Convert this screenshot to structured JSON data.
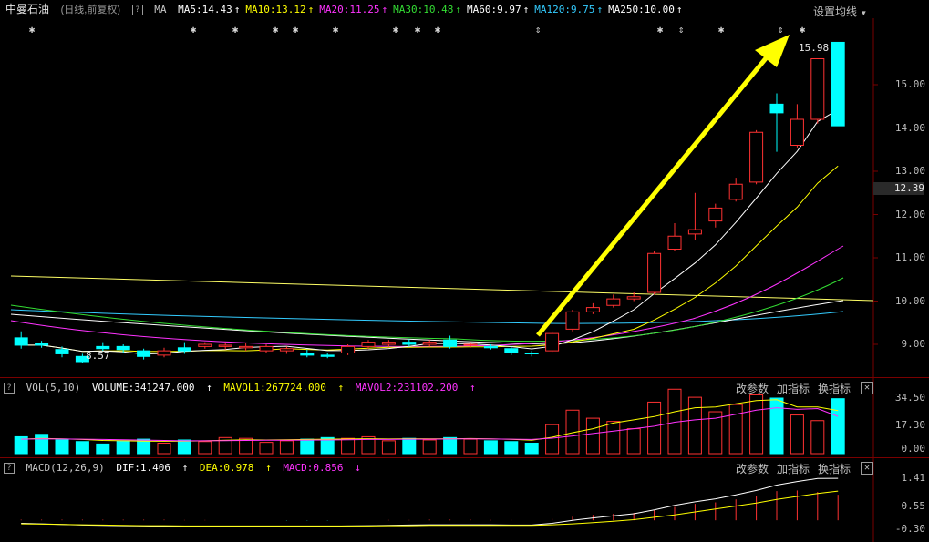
{
  "main": {
    "stock_name": "中曼石油",
    "mode": "(日线,前复权)",
    "indicator": "MA",
    "ma": [
      {
        "label": "MA5:14.43",
        "color": "#ffffff"
      },
      {
        "label": "MA10:13.12",
        "color": "#ffff00"
      },
      {
        "label": "MA20:11.25",
        "color": "#ff33ff"
      },
      {
        "label": "MA30:10.48",
        "color": "#33dd33"
      },
      {
        "label": "MA60:9.97",
        "color": "#ffffff"
      },
      {
        "label": "MA120:9.75",
        "color": "#33ccff"
      },
      {
        "label": "MA250:10.00",
        "color": "#ffffff"
      }
    ],
    "settings_label": "设置均线",
    "price_axis": [
      "15.00",
      "14.00",
      "13.00",
      "12.00",
      "11.00",
      "10.00",
      "9.00"
    ],
    "current_price": "12.39",
    "high_label": "15.98",
    "low_label": "8.57",
    "up_color": "#ff3232",
    "down_color": "#00ffff"
  },
  "volume": {
    "indicator": "VOL(5,10)",
    "volume_label": "VOLUME:341247.000",
    "mavol1_label": "MAVOL1:267724.000",
    "mavol2_label": "MAVOL2:231102.200",
    "axis": [
      "34.50",
      "17.30",
      "0.00"
    ]
  },
  "macd": {
    "indicator": "MACD(12,26,9)",
    "dif_label": "DIF:1.406",
    "dea_label": "DEA:0.978",
    "macd_label": "MACD:0.856",
    "axis": [
      "1.41",
      "0.55",
      "-0.30"
    ]
  },
  "panel_buttons": {
    "change_params": "改参数",
    "add_indicator": "加指标",
    "switch_indicator": "换指标"
  },
  "chart_data": {
    "type": "candlestick",
    "ylim": [
      8.5,
      16.3
    ],
    "candles": [
      {
        "o": 9.15,
        "c": 8.98,
        "h": 9.3,
        "l": 8.9
      },
      {
        "o": 9.02,
        "c": 8.98,
        "h": 9.08,
        "l": 8.92
      },
      {
        "o": 8.88,
        "c": 8.78,
        "h": 8.95,
        "l": 8.7
      },
      {
        "o": 8.72,
        "c": 8.6,
        "h": 8.78,
        "l": 8.57
      },
      {
        "o": 8.95,
        "c": 8.9,
        "h": 9.05,
        "l": 8.85
      },
      {
        "o": 8.95,
        "c": 8.88,
        "h": 9.0,
        "l": 8.8
      },
      {
        "o": 8.85,
        "c": 8.72,
        "h": 8.9,
        "l": 8.65
      },
      {
        "o": 8.75,
        "c": 8.85,
        "h": 8.92,
        "l": 8.7
      },
      {
        "o": 8.92,
        "c": 8.85,
        "h": 9.05,
        "l": 8.78
      },
      {
        "o": 8.95,
        "c": 9.0,
        "h": 9.05,
        "l": 8.9
      },
      {
        "o": 8.95,
        "c": 8.98,
        "h": 9.05,
        "l": 8.88
      },
      {
        "o": 8.92,
        "c": 8.95,
        "h": 9.02,
        "l": 8.85
      },
      {
        "o": 8.85,
        "c": 8.95,
        "h": 9.0,
        "l": 8.8
      },
      {
        "o": 8.85,
        "c": 8.9,
        "h": 8.95,
        "l": 8.78
      },
      {
        "o": 8.8,
        "c": 8.75,
        "h": 8.88,
        "l": 8.7
      },
      {
        "o": 8.75,
        "c": 8.72,
        "h": 8.8,
        "l": 8.68
      },
      {
        "o": 8.8,
        "c": 8.95,
        "h": 9.0,
        "l": 8.75
      },
      {
        "o": 8.95,
        "c": 9.05,
        "h": 9.1,
        "l": 8.9
      },
      {
        "o": 9.0,
        "c": 9.05,
        "h": 9.1,
        "l": 8.95
      },
      {
        "o": 9.05,
        "c": 9.0,
        "h": 9.12,
        "l": 8.95
      },
      {
        "o": 9.0,
        "c": 9.05,
        "h": 9.1,
        "l": 8.95
      },
      {
        "o": 9.1,
        "c": 8.95,
        "h": 9.2,
        "l": 8.9
      },
      {
        "o": 8.98,
        "c": 9.0,
        "h": 9.05,
        "l": 8.92
      },
      {
        "o": 8.95,
        "c": 8.92,
        "h": 9.0,
        "l": 8.88
      },
      {
        "o": 8.9,
        "c": 8.82,
        "h": 8.95,
        "l": 8.75
      },
      {
        "o": 8.8,
        "c": 8.78,
        "h": 8.85,
        "l": 8.72
      },
      {
        "o": 8.85,
        "c": 9.25,
        "h": 9.3,
        "l": 8.82
      },
      {
        "o": 9.35,
        "c": 9.75,
        "h": 9.8,
        "l": 9.3
      },
      {
        "o": 9.75,
        "c": 9.85,
        "h": 9.95,
        "l": 9.7
      },
      {
        "o": 9.9,
        "c": 10.05,
        "h": 10.15,
        "l": 9.85
      },
      {
        "o": 10.05,
        "c": 10.1,
        "h": 10.2,
        "l": 10.0
      },
      {
        "o": 10.2,
        "c": 11.1,
        "h": 11.15,
        "l": 10.15
      },
      {
        "o": 11.2,
        "c": 11.5,
        "h": 11.8,
        "l": 11.15
      },
      {
        "o": 11.55,
        "c": 11.65,
        "h": 12.5,
        "l": 11.4
      },
      {
        "o": 11.85,
        "c": 12.15,
        "h": 12.25,
        "l": 11.7
      },
      {
        "o": 12.35,
        "c": 12.7,
        "h": 12.85,
        "l": 12.3
      },
      {
        "o": 12.75,
        "c": 13.9,
        "h": 13.95,
        "l": 12.7
      },
      {
        "o": 14.55,
        "c": 14.35,
        "h": 14.8,
        "l": 13.45
      },
      {
        "o": 13.6,
        "c": 14.2,
        "h": 14.55,
        "l": 13.55
      },
      {
        "o": 14.2,
        "c": 15.6,
        "h": 15.6,
        "l": 14.1
      },
      {
        "o": 15.98,
        "c": 14.05,
        "h": 15.98,
        "l": 14.05
      }
    ],
    "volume": [
      10.5,
      12.0,
      8.5,
      7.5,
      6.0,
      8.0,
      9.0,
      6.5,
      8.5,
      7.5,
      10.0,
      9.5,
      7.0,
      8.0,
      9.0,
      10.0,
      9.5,
      10.5,
      8.0,
      9.5,
      8.5,
      10.0,
      9.0,
      8.0,
      7.5,
      6.5,
      18.0,
      27.0,
      22.0,
      20.0,
      15.5,
      32.0,
      40.0,
      35.0,
      26.0,
      30.5,
      36.5,
      34.5,
      24.0,
      20.5,
      34.12
    ],
    "mavol1": [
      9,
      9.5,
      9.2,
      8.8,
      8.2,
      8.0,
      7.8,
      7.7,
      7.8,
      8.0,
      8.3,
      8.6,
      8.5,
      8.6,
      8.8,
      9.0,
      9.1,
      9.3,
      9.1,
      9.3,
      9.2,
      9.3,
      9.4,
      9.2,
      8.9,
      8.3,
      10.2,
      13.0,
      15.5,
      19.0,
      21.0,
      23.0,
      26.0,
      28.5,
      29.0,
      31.0,
      33.0,
      33.5,
      29.0,
      29.0,
      26.77
    ],
    "mavol2": [
      9,
      9.2,
      9.1,
      9.0,
      8.8,
      8.6,
      8.4,
      8.2,
      8.0,
      8.0,
      8.1,
      8.2,
      8.3,
      8.3,
      8.4,
      8.5,
      8.6,
      8.8,
      8.8,
      9.0,
      9.0,
      9.1,
      9.2,
      9.1,
      9.0,
      8.8,
      9.6,
      11.0,
      12.5,
      14.0,
      15.5,
      17.0,
      19.5,
      21.0,
      22.0,
      24.5,
      27.0,
      28.5,
      27.5,
      28.0,
      23.11
    ],
    "macd_hist": [
      0.02,
      0.02,
      0.02,
      0.02,
      0.02,
      0.02,
      0.02,
      0.02,
      0.01,
      0.01,
      0.0,
      0.0,
      0.0,
      -0.01,
      -0.01,
      -0.01,
      0.0,
      0.0,
      0.01,
      0.01,
      0.02,
      0.02,
      0.02,
      0.01,
      0.01,
      0.0,
      0.05,
      0.12,
      0.18,
      0.22,
      0.25,
      0.35,
      0.45,
      0.55,
      0.6,
      0.7,
      0.82,
      0.98,
      1.0,
      0.95,
      0.856
    ],
    "dif": [
      -0.1,
      -0.12,
      -0.14,
      -0.16,
      -0.17,
      -0.18,
      -0.19,
      -0.2,
      -0.2,
      -0.2,
      -0.2,
      -0.2,
      -0.2,
      -0.2,
      -0.2,
      -0.2,
      -0.19,
      -0.18,
      -0.17,
      -0.16,
      -0.15,
      -0.15,
      -0.15,
      -0.15,
      -0.16,
      -0.16,
      -0.1,
      0.0,
      0.08,
      0.15,
      0.22,
      0.35,
      0.5,
      0.62,
      0.72,
      0.85,
      1.0,
      1.18,
      1.3,
      1.4,
      1.406
    ],
    "dea": [
      -0.12,
      -0.13,
      -0.14,
      -0.15,
      -0.16,
      -0.17,
      -0.18,
      -0.18,
      -0.19,
      -0.19,
      -0.19,
      -0.19,
      -0.19,
      -0.19,
      -0.19,
      -0.19,
      -0.19,
      -0.19,
      -0.18,
      -0.18,
      -0.17,
      -0.17,
      -0.17,
      -0.17,
      -0.17,
      -0.17,
      -0.15,
      -0.12,
      -0.08,
      -0.03,
      0.02,
      0.1,
      0.18,
      0.28,
      0.38,
      0.48,
      0.58,
      0.7,
      0.8,
      0.9,
      0.978
    ]
  }
}
